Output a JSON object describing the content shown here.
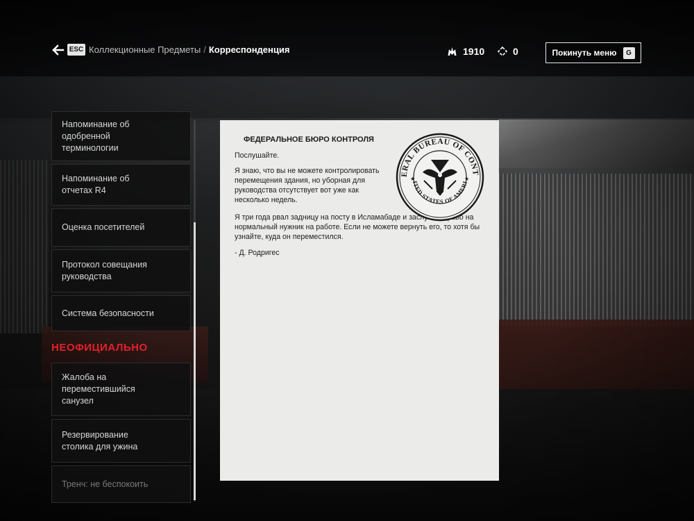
{
  "header": {
    "esc_key": "ESC",
    "breadcrumb_parent": "Коллекционные Предметы",
    "breadcrumb_separator": "/",
    "breadcrumb_current": "Корреспонденция",
    "source_count": "1910",
    "ability_points": "0",
    "quit_label": "Покинуть меню",
    "quit_key": "G"
  },
  "list": {
    "items": [
      {
        "line1": "Напоминание об",
        "line2": "одобренной",
        "line3": "терминологии"
      },
      {
        "line1": "Напоминание об",
        "line2": "отчетах R4",
        "line3": ""
      },
      {
        "line1": "Оценка посетителей",
        "line2": "",
        "line3": ""
      },
      {
        "line1": "Протокол совещания",
        "line2": "руководства",
        "line3": ""
      },
      {
        "line1": "Система безопасности",
        "line2": "",
        "line3": ""
      }
    ],
    "section_label": "НЕОФИЦИАЛЬНО",
    "unofficial_items": [
      {
        "line1": "Жалоба на",
        "line2": "переместившийся",
        "line3": "санузел"
      },
      {
        "line1": "Резервирование",
        "line2": "столика для ужина",
        "line3": ""
      },
      {
        "line1": "Тренч: не беспокоить",
        "line2": "",
        "line3": ""
      }
    ]
  },
  "document": {
    "title": "ФЕДЕРАЛЬНОЕ БЮРО КОНТРОЛЯ",
    "greeting": "Послушайте.",
    "paragraph1": "Я знаю, что вы не можете контролировать перемещения здания, но уборная для руководства отсутствует вот уже как несколько недель.",
    "paragraph2": "Я три года рвал задницу на посту в Исламабаде и заслужил право на нормальный нужник на работе. Если не можете вернуть его, то хотя бы узнайте, куда он переместился.",
    "signature": "- Д. Родригес",
    "seal_outer_text": "FEDERAL BUREAU OF CONTROL",
    "seal_bottom_text": "UNITED STATES OF AMERICA"
  },
  "colors": {
    "accent_red": "#e3202a",
    "document_paper": "#ebebea",
    "list_bg": "#101010"
  }
}
